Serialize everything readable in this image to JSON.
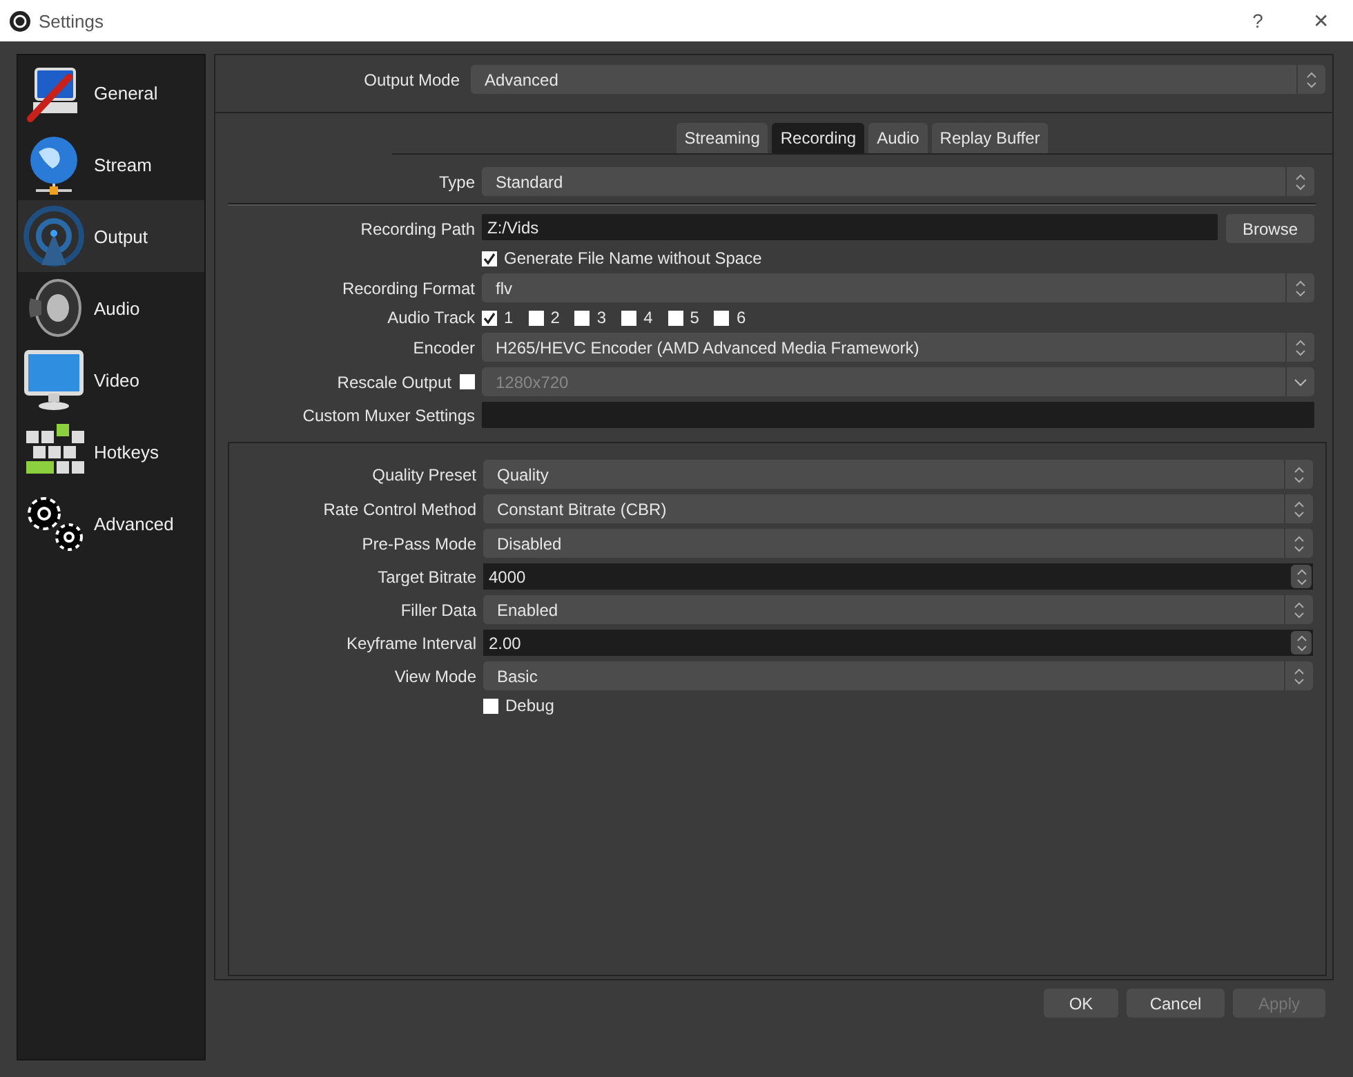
{
  "window": {
    "title": "Settings",
    "help": "?",
    "close": "✕"
  },
  "sidebar": {
    "items": [
      {
        "label": "General",
        "selected": false
      },
      {
        "label": "Stream",
        "selected": false
      },
      {
        "label": "Output",
        "selected": true
      },
      {
        "label": "Audio",
        "selected": false
      },
      {
        "label": "Video",
        "selected": false
      },
      {
        "label": "Hotkeys",
        "selected": false
      },
      {
        "label": "Advanced",
        "selected": false
      }
    ]
  },
  "output_mode": {
    "label": "Output Mode",
    "value": "Advanced"
  },
  "tabs": [
    {
      "label": "Streaming",
      "selected": false
    },
    {
      "label": "Recording",
      "selected": true
    },
    {
      "label": "Audio",
      "selected": false
    },
    {
      "label": "Replay Buffer",
      "selected": false
    }
  ],
  "recording": {
    "type": {
      "label": "Type",
      "value": "Standard"
    },
    "rows": [
      {
        "kind": "path",
        "label": "Recording Path",
        "value": "Z:/Vids",
        "button": "Browse"
      },
      {
        "kind": "check",
        "text": "Generate File Name without Space",
        "checked": true
      },
      {
        "kind": "select",
        "label": "Recording Format",
        "value": "flv"
      },
      {
        "kind": "tracks",
        "label": "Audio Track",
        "tracks": [
          {
            "label": "1",
            "checked": true
          },
          {
            "label": "2",
            "checked": false
          },
          {
            "label": "3",
            "checked": false
          },
          {
            "label": "4",
            "checked": false
          },
          {
            "label": "5",
            "checked": false
          },
          {
            "label": "6",
            "checked": false
          }
        ]
      },
      {
        "kind": "select",
        "label": "Encoder",
        "value": "H265/HEVC Encoder (AMD Advanced Media Framework)"
      },
      {
        "kind": "rescale",
        "label": "Rescale Output",
        "checked": false,
        "value": "1280x720",
        "disabled": true
      },
      {
        "kind": "text",
        "label": "Custom Muxer Settings"
      }
    ]
  },
  "encoder_settings": {
    "rows": [
      {
        "kind": "select",
        "label": "Quality Preset",
        "value": "Quality"
      },
      {
        "kind": "select",
        "label": "Rate Control Method",
        "value": "Constant Bitrate (CBR)"
      },
      {
        "kind": "select",
        "label": "Pre-Pass Mode",
        "value": "Disabled"
      },
      {
        "kind": "spin",
        "label": "Target Bitrate",
        "value": "4000"
      },
      {
        "kind": "select",
        "label": "Filler Data",
        "value": "Enabled"
      },
      {
        "kind": "spin",
        "label": "Keyframe Interval",
        "value": "2.00"
      },
      {
        "kind": "select",
        "label": "View Mode",
        "value": "Basic"
      },
      {
        "kind": "check",
        "text": "Debug",
        "checked": false
      }
    ]
  },
  "buttons": [
    {
      "label": "OK",
      "disabled": false
    },
    {
      "label": "Cancel",
      "disabled": false
    },
    {
      "label": "Apply",
      "disabled": true
    }
  ]
}
